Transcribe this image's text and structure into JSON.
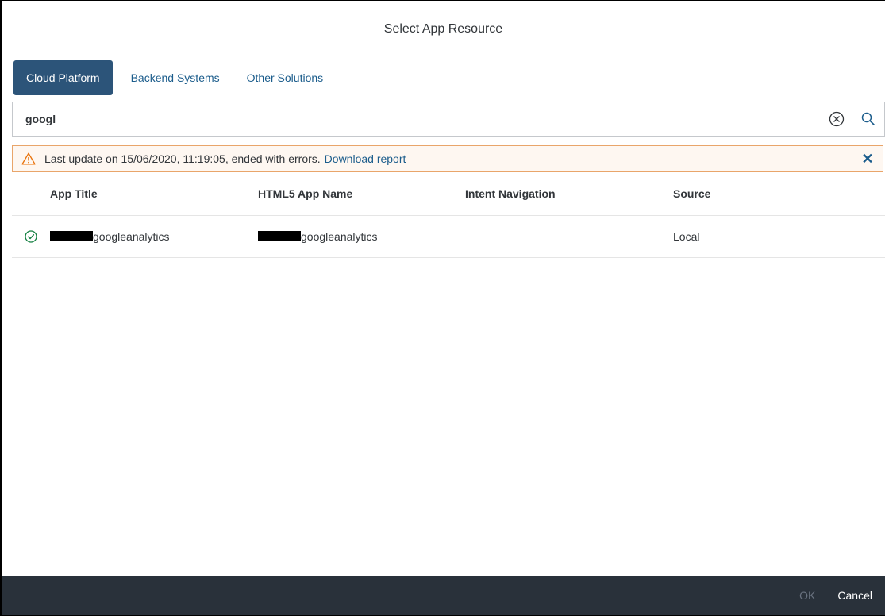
{
  "dialog": {
    "title": "Select App Resource"
  },
  "tabs": [
    {
      "label": "Cloud Platform",
      "active": true
    },
    {
      "label": "Backend Systems",
      "active": false
    },
    {
      "label": "Other Solutions",
      "active": false
    }
  ],
  "search": {
    "value": "googl",
    "clear_icon": "clear-circle-x-icon",
    "search_icon": "magnifier-icon"
  },
  "warning": {
    "icon": "warning-triangle-icon",
    "text": "Last update on 15/06/2020, 11:19:05, ended with errors.",
    "link": "Download report",
    "close_icon": "close-x-icon",
    "color": "#e9a56a"
  },
  "table": {
    "columns": [
      "App Title",
      "HTML5 App Name",
      "Intent Navigation",
      "Source"
    ],
    "rows": [
      {
        "status_icon": "success-check-circle-icon",
        "app_title": "googleanalytics",
        "html5_app_name": "googleanalytics",
        "intent_navigation": "",
        "source": "Local"
      }
    ]
  },
  "footer": {
    "ok_label": "OK",
    "cancel_label": "Cancel"
  },
  "colors": {
    "active_tab_bg": "#2c5479",
    "link": "#1c5d8c",
    "footer_bg": "#29313a",
    "success": "#107e3e"
  }
}
